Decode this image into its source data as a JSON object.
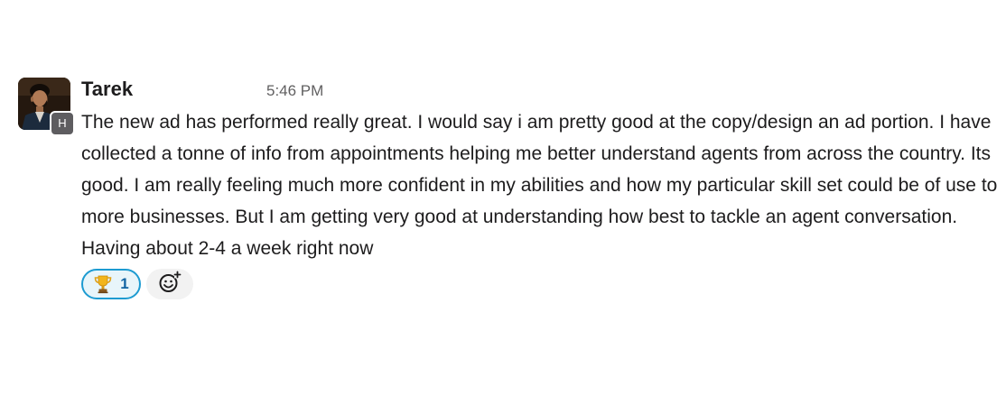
{
  "message": {
    "author": "Tarek",
    "timestamp": "5:46 PM",
    "presence_badge": "H",
    "text": "The new ad has performed really great. I would say i am pretty good at the copy/design an ad portion. I have collected a tonne of info from appointments helping me better understand agents from across the country. Its good. I am really feeling much more confident in my abilities and how my particular skill set could be of use to more businesses. But I am getting very good at understanding how best to tackle an agent conversation. Having about 2-4 a week right now"
  },
  "reactions": [
    {
      "emoji": "trophy-icon",
      "count": "1"
    }
  ],
  "add_reaction": {
    "icon": "add-emoji-icon"
  },
  "colors": {
    "reaction_border": "#1d9bd1",
    "reaction_bg": "#e8f5fa",
    "reaction_count": "#1264a3",
    "timestamp": "#616061",
    "text": "#1d1c1d"
  }
}
